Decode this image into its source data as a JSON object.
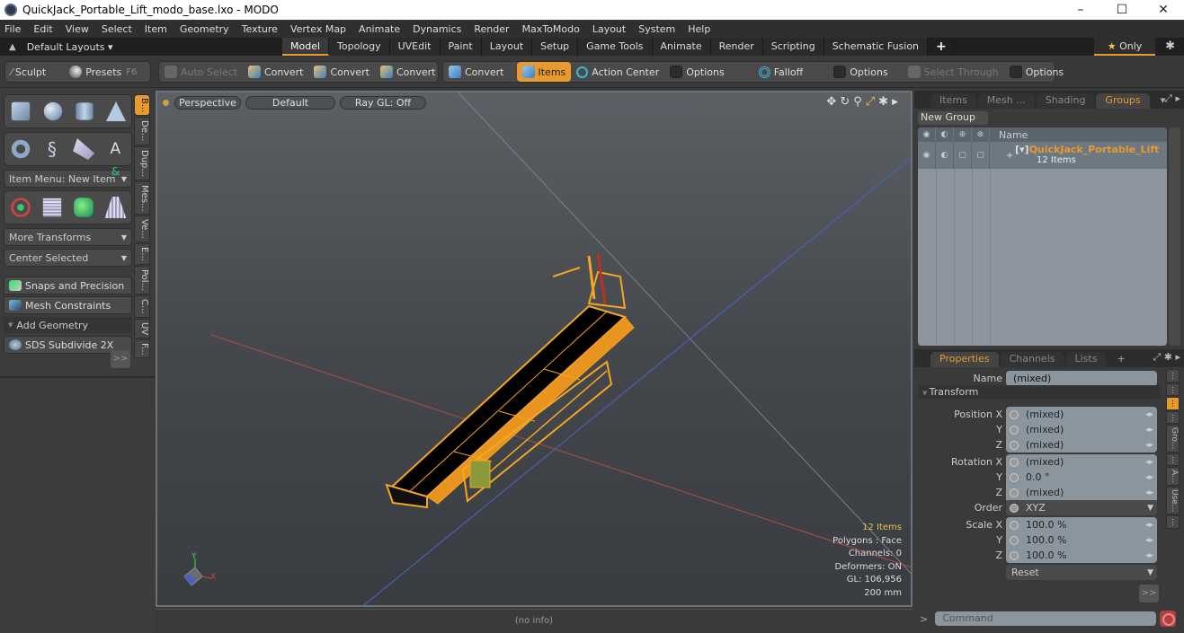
{
  "window": {
    "title": "QuickJack_Portable_Lift_modo_base.lxo - MODO",
    "controls": [
      "–",
      "☐",
      "✕"
    ]
  },
  "menubar": [
    "File",
    "Edit",
    "View",
    "Select",
    "Item",
    "Geometry",
    "Texture",
    "Vertex Map",
    "Animate",
    "Dynamics",
    "Render",
    "MaxToModo",
    "Layout",
    "System",
    "Help"
  ],
  "layoutbar": {
    "default_layouts": "Default Layouts ▾",
    "tabs": [
      "Model",
      "Topology",
      "UVEdit",
      "Paint",
      "Layout",
      "Setup",
      "Game Tools",
      "Animate",
      "Render",
      "Scripting",
      "Schematic Fusion"
    ],
    "active_tab": "Model",
    "plus": "+",
    "only": "Only",
    "star": "★"
  },
  "toolbar": {
    "sculpt": "Sculpt",
    "presets": "Presets",
    "presets_key": "F6",
    "auto_select": "Auto Select",
    "convert1": "Convert",
    "convert2": "Convert",
    "convert3": "Convert",
    "convert4": "Convert",
    "items": "Items",
    "action_center": "Action Center",
    "options1": "Options",
    "falloff": "Falloff",
    "options2": "Options",
    "select_through": "Select Through",
    "options3": "Options"
  },
  "leftpanel": {
    "item_menu": "Item Menu: New Item",
    "more_transforms": "More Transforms",
    "center_selected": "Center Selected",
    "snaps": "Snaps and Precision",
    "mesh_constraints": "Mesh Constraints",
    "add_geometry": "Add Geometry",
    "sds_subdivide": "SDS Subdivide 2X",
    "more": ">>",
    "vtabs": [
      "B...",
      "De...",
      "Dup...",
      "Mes...",
      "Ve...",
      "E...",
      "Pol...",
      "C...",
      "UV",
      "F..."
    ]
  },
  "viewport": {
    "view": "Perspective",
    "shading": "Default",
    "raygl": "Ray GL: Off",
    "info": {
      "items": "12 Items",
      "polygons": "Polygons : Face",
      "channels": "Channels: 0",
      "deformers": "Deformers: ON",
      "gl": "GL: 106,956",
      "unit": "200 mm"
    },
    "axis_y": "Y",
    "axis_x": "X"
  },
  "status": "(no info)",
  "groups_panel": {
    "tabs": [
      "Items",
      "Mesh ...",
      "Shading",
      "Groups"
    ],
    "active_tab": "Groups",
    "new_group": "New Group",
    "name_header": "Name",
    "group_name": "QuickJack_Portable_Lift",
    "group_sub": "12 Items"
  },
  "properties_panel": {
    "tabs": [
      "Properties",
      "Channels",
      "Lists"
    ],
    "active_tab": "Properties",
    "plus": "+",
    "name_label": "Name",
    "name_value": "(mixed)",
    "transform": "Transform",
    "rows": [
      {
        "label": "Position X",
        "value": "(mixed)"
      },
      {
        "label": "Y",
        "value": "(mixed)"
      },
      {
        "label": "Z",
        "value": "(mixed)"
      },
      {
        "label": "Rotation X",
        "value": "(mixed)"
      },
      {
        "label": "Y",
        "value": "0.0 °"
      },
      {
        "label": "Z",
        "value": "(mixed)"
      },
      {
        "label": "Order",
        "value": "XYZ"
      },
      {
        "label": "Scale X",
        "value": "100.0 %"
      },
      {
        "label": "Y",
        "value": "100.0 %"
      },
      {
        "label": "Z",
        "value": "100.0 %"
      }
    ],
    "reset": "Reset",
    "more": ">>",
    "vtabs": [
      "...",
      "...",
      "...",
      "...",
      "Gro...",
      "...",
      "A...",
      "Use...",
      "..."
    ]
  },
  "command": {
    "prompt": ">",
    "placeholder": "Command"
  },
  "colors": {
    "accent": "#e89a2c",
    "selection": "#f5a623"
  }
}
